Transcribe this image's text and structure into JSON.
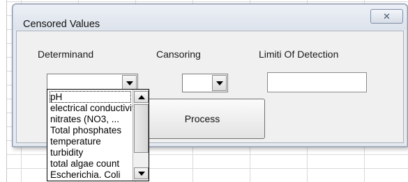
{
  "dialog": {
    "title": "Censored Values",
    "close_glyph": "✕"
  },
  "labels": {
    "determinand": "Determinand",
    "censoring": "Cansoring",
    "limit_of_detection": "Limiti Of Detection"
  },
  "inputs": {
    "determinand_value": "",
    "censoring_value": "",
    "limit_of_detection_value": ""
  },
  "buttons": {
    "process": "Process"
  },
  "dropdown": {
    "items": [
      "pH",
      "electrical conductivity",
      "nitrates (NO3, ...",
      "Total phosphates",
      "temperature",
      "turbidity",
      "total algae count",
      "Escherichia. Coli"
    ],
    "selected_index": 0
  },
  "icons": {
    "close": "close-icon",
    "dropdown_arrow": "chevron-down-icon",
    "scroll_up": "scroll-up-icon",
    "scroll_down": "scroll-down-icon"
  }
}
